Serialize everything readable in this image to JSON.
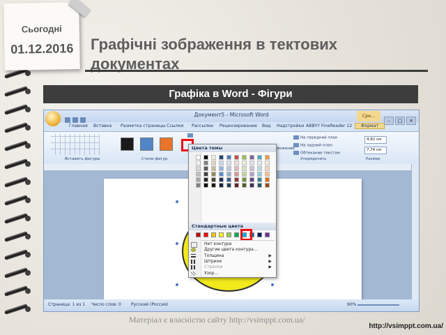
{
  "slide": {
    "today_label": "Сьогодні",
    "date": "01.12.2016",
    "title": "Графічні зображення в тектових документах",
    "subtitle": "Графіка в Word - Фігури",
    "caption": "Матеріал є власністю сайту http://vsimppt.com.ua/",
    "site_url": "http://vsimppt.com.ua/"
  },
  "word": {
    "window_title": "Документ5 - Microsoft Word",
    "context_tab": "Сре...",
    "tabs": [
      {
        "label": "Главная"
      },
      {
        "label": "Вставка"
      },
      {
        "label": "Разметка страницы"
      },
      {
        "label": "Ссылки"
      },
      {
        "label": "Рассылки"
      },
      {
        "label": "Рецензирование"
      },
      {
        "label": "Вид"
      },
      {
        "label": "Надстройки"
      },
      {
        "label": "ABBYY FineReader 12"
      },
      {
        "label": "Формат"
      }
    ],
    "ribbon": {
      "group_insert_shapes": "Вставить фигуры",
      "group_shape_styles": "Стили фигур",
      "group_arrange": "Упорядочить",
      "group_size": "Размер",
      "front_label": "На передний план",
      "back_label": "На задний план",
      "wrap_label": "Обтекание текстом",
      "wrap_label_left": "ложение",
      "height_value": "4,82 см",
      "width_value": "7,74 см",
      "shape_style_colors": [
        "#1a1a1a",
        "#4f86c6",
        "#e8742a"
      ]
    },
    "status": {
      "page": "Страница: 1 из 1",
      "words": "Число слов: 0",
      "language": "Русский (Россия)",
      "zoom": "90%"
    }
  },
  "dropdown": {
    "theme_colors_header": "Цвета темы",
    "standard_colors_header": "Стандартные цвета",
    "theme_palette": [
      [
        "#ffffff",
        "#f2f2f2",
        "#d9d9d9",
        "#bfbfbf",
        "#a6a6a6",
        "#7f7f7f"
      ],
      [
        "#000000",
        "#7f7f7f",
        "#595959",
        "#3f3f3f",
        "#262626",
        "#0d0d0d"
      ],
      [
        "#eeece1",
        "#ddd9c3",
        "#c4bd97",
        "#948a54",
        "#4a452a",
        "#1d1b10"
      ],
      [
        "#1f497d",
        "#c6d9f0",
        "#8db3e2",
        "#548dd4",
        "#17365d",
        "#0f243e"
      ],
      [
        "#4f81bd",
        "#dbe5f1",
        "#b8cce4",
        "#95b3d7",
        "#366092",
        "#244061"
      ],
      [
        "#c0504d",
        "#f2dcdb",
        "#e5b9b7",
        "#d99694",
        "#953734",
        "#632423"
      ],
      [
        "#9bbb59",
        "#ebf1dd",
        "#d7e3bc",
        "#c3d69b",
        "#76923c",
        "#4f6128"
      ],
      [
        "#8064a2",
        "#e5e0ec",
        "#ccc1d9",
        "#b2a2c7",
        "#5f497a",
        "#3f3151"
      ],
      [
        "#4bacc6",
        "#dbeef3",
        "#b7dde8",
        "#92cddc",
        "#31859b",
        "#205867"
      ],
      [
        "#f79646",
        "#fdeada",
        "#fbd5b5",
        "#fac08f",
        "#e36c09",
        "#974806"
      ]
    ],
    "standard_palette": [
      "#c00000",
      "#ff0000",
      "#ffc000",
      "#ffff00",
      "#92d050",
      "#00b050",
      "#00b0f0",
      "#0070c0",
      "#002060",
      "#7030a0"
    ],
    "items": [
      {
        "label": "Нет контура",
        "arrow": ""
      },
      {
        "label": "Другие цвета контура...",
        "arrow": ""
      },
      {
        "label": "Толщина",
        "arrow": "▶"
      },
      {
        "label": "Штрихи",
        "arrow": "▶"
      },
      {
        "label": "Стрелки",
        "arrow": "▶"
      },
      {
        "label": "Узор...",
        "arrow": ""
      }
    ]
  }
}
